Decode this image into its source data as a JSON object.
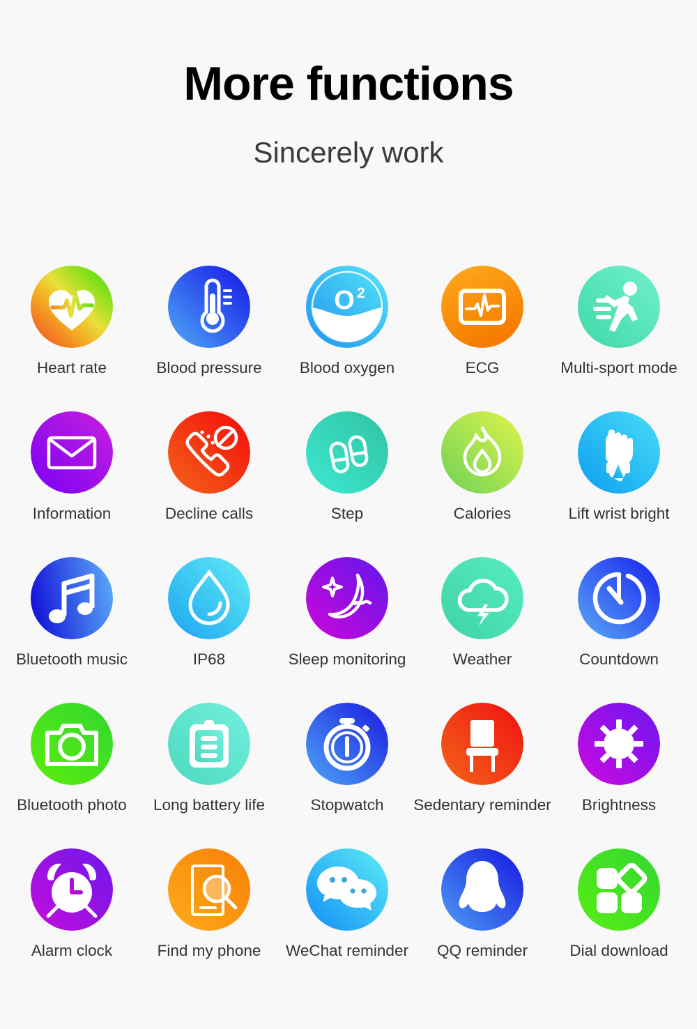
{
  "header": {
    "title": "More functions",
    "subtitle": "Sincerely work"
  },
  "background_color": "#f8f8f8",
  "label_color": "#333333",
  "features": [
    {
      "label": "Heart rate",
      "icon": "heart-rate-icon",
      "gradient_from": "#ef4023",
      "gradient_to": "#2ee000"
    },
    {
      "label": "Blood pressure",
      "icon": "thermometer-icon",
      "gradient_from": "#4da8f5",
      "gradient_to": "#1616e8"
    },
    {
      "label": "Blood oxygen",
      "icon": "blood-oxygen-icon",
      "gradient_from": "#2196f3",
      "gradient_to": "#4fe3f5"
    },
    {
      "label": "ECG",
      "icon": "ecg-monitor-icon",
      "gradient_from": "#ffa41c",
      "gradient_to": "#f57c00"
    },
    {
      "label": "Multi-sport mode",
      "icon": "running-person-icon",
      "gradient_from": "#4ce0b0",
      "gradient_to": "#6ef0c8"
    },
    {
      "label": "Information",
      "icon": "envelope-icon",
      "gradient_from": "#8a00f0",
      "gradient_to": "#c21ddc"
    },
    {
      "label": "Decline calls",
      "icon": "decline-call-icon",
      "gradient_from": "#f2651a",
      "gradient_to": "#f40a0a"
    },
    {
      "label": "Step",
      "icon": "footprints-icon",
      "gradient_from": "#36e5d0",
      "gradient_to": "#33c9a6"
    },
    {
      "label": "Calories",
      "icon": "flame-icon",
      "gradient_from": "#7ed957",
      "gradient_to": "#d8f54a"
    },
    {
      "label": "Lift wrist bright",
      "icon": "lift-wrist-icon",
      "gradient_from": "#0e9ef0",
      "gradient_to": "#3fd8f5"
    },
    {
      "label": "Bluetooth music",
      "icon": "music-note-icon",
      "gradient_from": "#1212d8",
      "gradient_to": "#4f9ff5"
    },
    {
      "label": "IP68",
      "icon": "water-drop-icon",
      "gradient_from": "#1aa4f0",
      "gradient_to": "#5fe8f2"
    },
    {
      "label": "Sleep monitoring",
      "icon": "moon-star-icon",
      "gradient_from": "#c707d8",
      "gradient_to": "#6b16e8"
    },
    {
      "label": "Weather",
      "icon": "cloud-lightning-icon",
      "gradient_from": "#4ce8bb",
      "gradient_to": "#3ed6a8"
    },
    {
      "label": "Countdown",
      "icon": "countdown-clock-icon",
      "gradient_from": "#4fa0f5",
      "gradient_to": "#1722ef"
    },
    {
      "label": "Bluetooth photo",
      "icon": "camera-icon",
      "gradient_from": "#5ced0c",
      "gradient_to": "#2fd62f"
    },
    {
      "label": "Long battery life",
      "icon": "clipboard-icon",
      "gradient_from": "#55e0c5",
      "gradient_to": "#6beddc"
    },
    {
      "label": "Stopwatch",
      "icon": "stopwatch-icon",
      "gradient_from": "#3d9cf5",
      "gradient_to": "#1a1ae0"
    },
    {
      "label": "Sedentary reminder",
      "icon": "chair-icon",
      "gradient_from": "#f2651a",
      "gradient_to": "#ef1010"
    },
    {
      "label": "Brightness",
      "icon": "sun-brightness-icon",
      "gradient_from": "#cc0ae0",
      "gradient_to": "#6b16f0"
    },
    {
      "label": "Alarm clock",
      "icon": "alarm-clock-icon",
      "gradient_from": "#c40ddc",
      "gradient_to": "#6b18ea"
    },
    {
      "label": "Find my phone",
      "icon": "find-phone-icon",
      "gradient_from": "#ffa81c",
      "gradient_to": "#f77f05"
    },
    {
      "label": "WeChat reminder",
      "icon": "wechat-icon",
      "gradient_from": "#128ef5",
      "gradient_to": "#4fe8f2"
    },
    {
      "label": "QQ reminder",
      "icon": "qq-penguin-icon",
      "gradient_from": "#3d93f5",
      "gradient_to": "#1616e0"
    },
    {
      "label": "Dial download",
      "icon": "dial-download-icon",
      "gradient_from": "#58ed14",
      "gradient_to": "#2ed82e"
    }
  ]
}
